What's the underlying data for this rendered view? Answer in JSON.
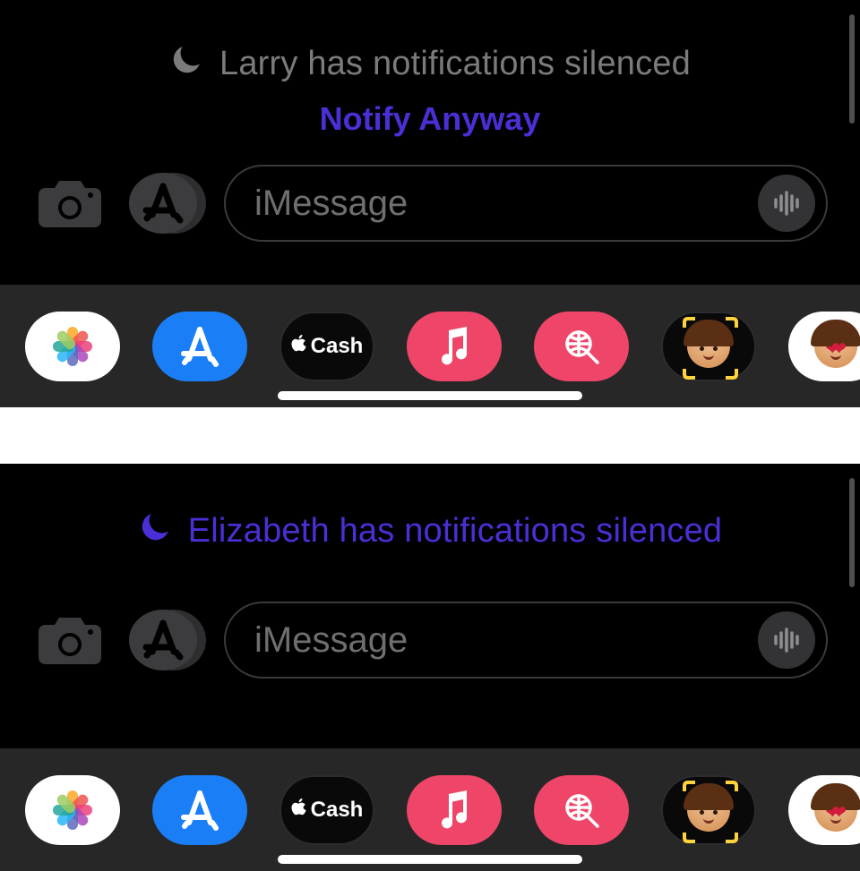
{
  "panels": [
    {
      "silenced_text": "Larry has notifications silenced",
      "silenced_color": "gray",
      "show_notify_anyway": true,
      "notify_anyway_label": "Notify Anyway",
      "input_placeholder": "iMessage"
    },
    {
      "silenced_text": "Elizabeth has notifications silenced",
      "silenced_color": "purple",
      "show_notify_anyway": false,
      "input_placeholder": "iMessage"
    }
  ],
  "app_bar": {
    "cash_label": "Cash"
  },
  "colors": {
    "accent_purple": "#4b2fd6",
    "music_red": "#ef4569",
    "appstore_blue": "#1a7ff7"
  },
  "petals": [
    "#f9a825",
    "#ef5350",
    "#ec407a",
    "#ab47bc",
    "#5c6bc0",
    "#29b6f6",
    "#26a69a",
    "#9ccc65"
  ]
}
